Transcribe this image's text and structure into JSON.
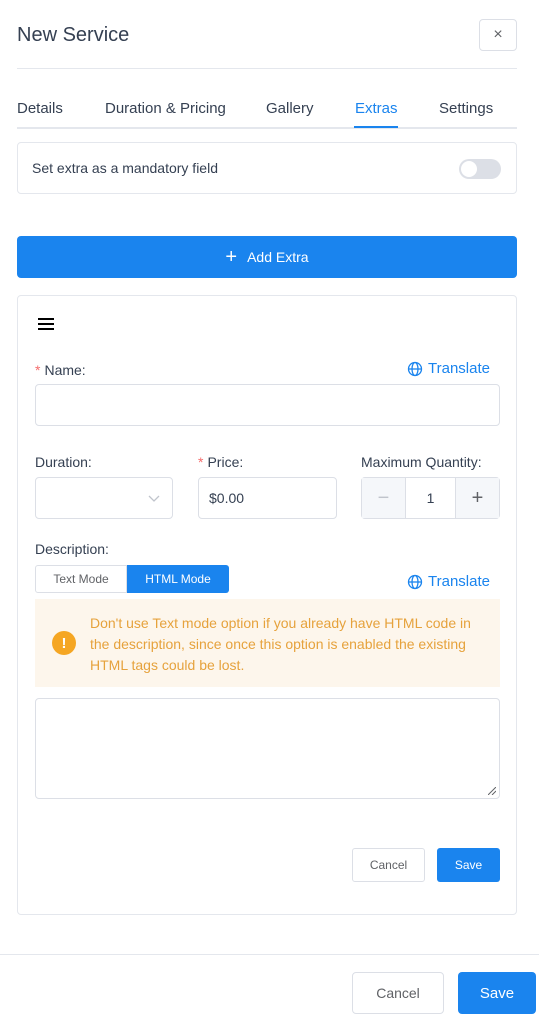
{
  "header": {
    "title": "New Service",
    "close_icon": "×"
  },
  "tabs": [
    {
      "label": "Details"
    },
    {
      "label": "Duration & Pricing"
    },
    {
      "label": "Gallery"
    },
    {
      "label": "Extras",
      "active": true
    },
    {
      "label": "Settings"
    }
  ],
  "mandatory": {
    "label": "Set extra as a mandatory field",
    "enabled": false
  },
  "add_extra": {
    "icon": "+",
    "label": "Add Extra"
  },
  "extra": {
    "name_label": "Name:",
    "required_mark": "*",
    "translate_label": "Translate",
    "name_value": "",
    "duration_label": "Duration:",
    "duration_value": "",
    "price_label": "Price:",
    "price_value": "$0.00",
    "max_qty_label": "Maximum Quantity:",
    "qty_minus": "−",
    "qty_value": "1",
    "qty_plus": "+",
    "description_label": "Description:",
    "mode_text": "Text Mode",
    "mode_html": "HTML Mode",
    "active_mode": "HTML Mode",
    "warning_icon": "!",
    "warning_text": "Don't use Text mode option if you already have HTML code in the description, since once this option is enabled the existing HTML tags could be lost.",
    "description_value": "",
    "cancel_label": "Cancel",
    "save_label": "Save"
  },
  "footer": {
    "cancel_label": "Cancel",
    "save_label": "Save"
  },
  "colors": {
    "accent": "#1a84ee",
    "warning_bg": "#fdf6ec",
    "warning_text": "#e6a23c",
    "warning_icon": "#f5a623",
    "required": "#f56c6c"
  }
}
